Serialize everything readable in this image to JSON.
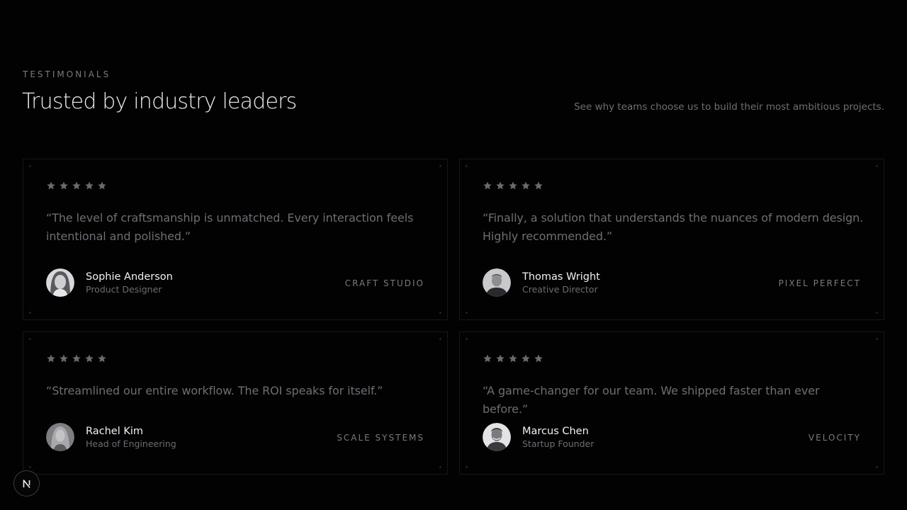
{
  "header": {
    "eyebrow": "TESTIMONIALS",
    "title": "Trusted by industry leaders",
    "subtitle": "See why teams choose us to build their most ambitious projects."
  },
  "testimonials": [
    {
      "rating": 5,
      "quote": "“The level of craftsmanship is unmatched. Every interaction feels intentional and polished.”",
      "name": "Sophie Anderson",
      "role": "Product Designer",
      "company": "CRAFT STUDIO"
    },
    {
      "rating": 5,
      "quote": "“Finally, a solution that understands the nuances of modern design. Highly recommended.”",
      "name": "Thomas Wright",
      "role": "Creative Director",
      "company": "PIXEL PERFECT"
    },
    {
      "rating": 5,
      "quote": "“Streamlined our entire workflow. The ROI speaks for itself.”",
      "name": "Rachel Kim",
      "role": "Head of Engineering",
      "company": "SCALE SYSTEMS"
    },
    {
      "rating": 5,
      "quote": "“A game-changer for our team. We shipped faster than ever before.”",
      "name": "Marcus Chen",
      "role": "Startup Founder",
      "company": "VELOCITY"
    }
  ],
  "colors": {
    "background": "#020203",
    "card_border": "#16171d",
    "star": "#6a6a70",
    "heading": "#ececee",
    "muted": "#6e6e74"
  },
  "floating_button": {
    "icon": "nextjs-logo-icon"
  }
}
